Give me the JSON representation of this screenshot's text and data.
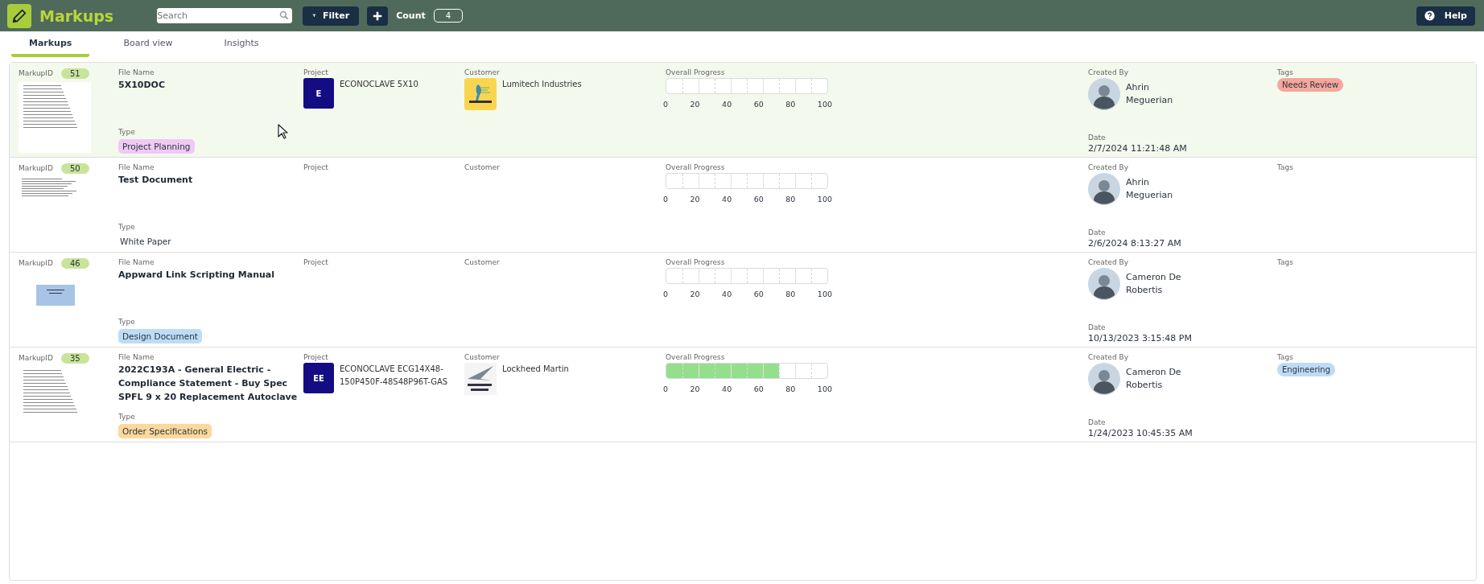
{
  "header": {
    "title": "Markups",
    "search": {
      "placeholder": "Search"
    },
    "filter_button": "Filter",
    "count_label": "Count",
    "count": "4",
    "help_button": "Help"
  },
  "tabs": [
    {
      "label": "Markups",
      "selected": true
    },
    {
      "label": "Board view",
      "selected": false
    },
    {
      "label": "Insights",
      "selected": false
    }
  ],
  "markups": [
    {
      "selected": true,
      "labels": {
        "markup_id": "MarkupID",
        "file_name": "File Name",
        "type": "Type",
        "project": "Project",
        "customer": "Customer",
        "progress": "Overall Progress",
        "created_by": "Created By",
        "date": "Date",
        "tags": "Tags"
      },
      "id": "51",
      "thumbnail": {
        "kind": "page"
      },
      "file_name": "5X10DOC",
      "type": {
        "label": "Project Planning",
        "color": "#eecaf4"
      },
      "project": {
        "logo_text": "E",
        "name": "ECONOCLAVE 5X10"
      },
      "customer": {
        "kind": "square",
        "name": "Lumitech Industries"
      },
      "progress": {
        "level": 0,
        "scale": [
          "0",
          "20",
          "40",
          "60",
          "80",
          "100"
        ]
      },
      "created_by": {
        "name": "Ahrin Meguerian"
      },
      "date": "2/7/2024 11:21:48 AM",
      "tags": [
        {
          "label": "Needs Review",
          "color": "#f6a79c"
        }
      ]
    },
    {
      "selected": false,
      "labels": {
        "markup_id": "MarkupID",
        "file_name": "File Name",
        "type": "Type",
        "project": "Project",
        "customer": "Customer",
        "progress": "Overall Progress",
        "created_by": "Created By",
        "date": "Date",
        "tags": "Tags"
      },
      "id": "50",
      "thumbnail": {
        "kind": "text"
      },
      "file_name": "Test Document",
      "type": {
        "label": "White Paper"
      },
      "progress": {
        "level": 0,
        "scale": [
          "0",
          "20",
          "40",
          "60",
          "80",
          "100"
        ]
      },
      "created_by": {
        "name": "Ahrin Meguerian"
      },
      "date": "2/6/2024 8:13:27 AM"
    },
    {
      "selected": false,
      "labels": {
        "markup_id": "MarkupID",
        "file_name": "File Name",
        "type": "Type",
        "project": "Project",
        "customer": "Customer",
        "progress": "Overall Progress",
        "created_by": "Created By",
        "date": "Date",
        "tags": "Tags"
      },
      "id": "46",
      "thumbnail": {
        "kind": "slide"
      },
      "file_name": "Appward Link Scripting Manual",
      "type": {
        "label": "Design Document",
        "color": "#bddcf6"
      },
      "progress": {
        "level": 0,
        "scale": [
          "0",
          "20",
          "40",
          "60",
          "80",
          "100"
        ]
      },
      "created_by": {
        "name": "Cameron De Robertis"
      },
      "date": "10/13/2023 3:15:48 PM"
    },
    {
      "selected": false,
      "labels": {
        "markup_id": "MarkupID",
        "file_name": "File Name",
        "type": "Type",
        "project": "Project",
        "customer": "Customer",
        "progress": "Overall Progress",
        "created_by": "Created By",
        "date": "Date",
        "tags": "Tags"
      },
      "id": "35",
      "thumbnail": {
        "kind": "page"
      },
      "file_name": "2022C193A - General Electric - Compliance Statement - Buy Spec SPFL 9 x 20 Replacement Autoclave",
      "type": {
        "label": "Order Specifications",
        "color": "#fcd89b"
      },
      "project": {
        "logo_text": "EE",
        "name": "ECONOCLAVE ECG14X48-150P450F-48S48P96T-GAS"
      },
      "customer": {
        "kind": "wing",
        "name": "Lockheed Martin"
      },
      "progress": {
        "level": 0.7,
        "scale": [
          "0",
          "20",
          "40",
          "60",
          "80",
          "100"
        ]
      },
      "created_by": {
        "name": "Cameron De Robertis"
      },
      "date": "1/24/2023 10:45:35 AM",
      "tags": [
        {
          "label": "Engineering",
          "color": "#bddcf6"
        }
      ]
    }
  ]
}
